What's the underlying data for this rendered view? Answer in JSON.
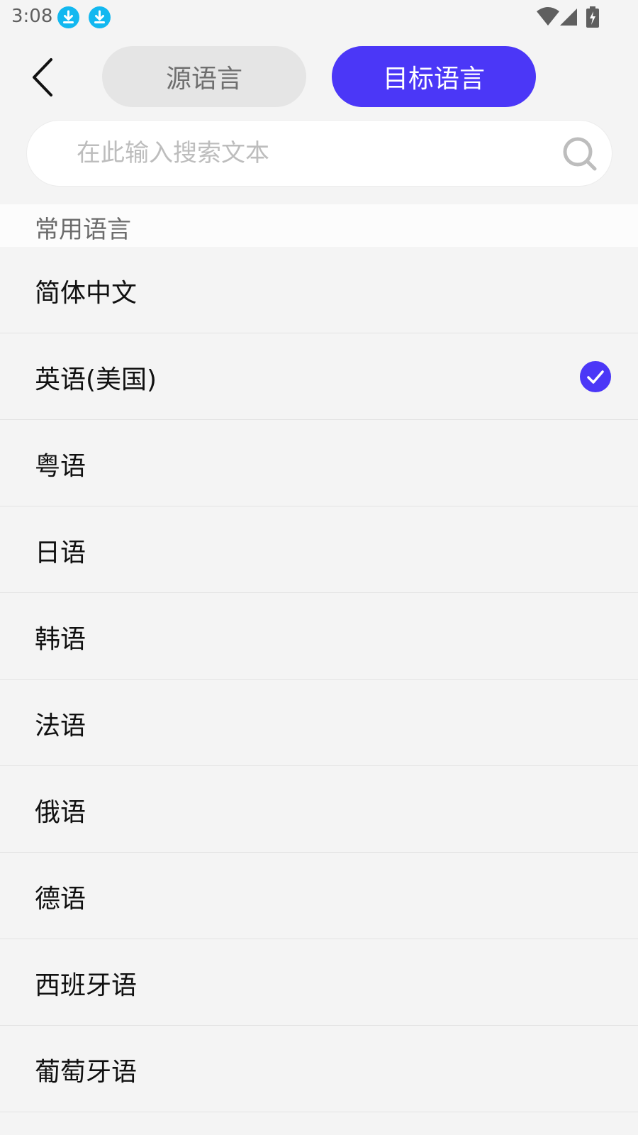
{
  "status_bar": {
    "time": "3:08",
    "left_icons": [
      "download-icon",
      "download-icon"
    ],
    "right_icons": [
      "wifi-icon",
      "cellular-signal-icon",
      "battery-charging-icon"
    ]
  },
  "header": {
    "back_icon": "chevron-left-icon",
    "tabs": [
      {
        "label": "源语言",
        "active": false
      },
      {
        "label": "目标语言",
        "active": true
      }
    ]
  },
  "search": {
    "placeholder": "在此输入搜索文本",
    "value": "",
    "icon": "search-icon"
  },
  "section": {
    "title": "常用语言"
  },
  "languages": [
    {
      "label": "简体中文",
      "selected": false
    },
    {
      "label": "英语(美国)",
      "selected": true
    },
    {
      "label": "粤语",
      "selected": false
    },
    {
      "label": "日语",
      "selected": false
    },
    {
      "label": "韩语",
      "selected": false
    },
    {
      "label": "法语",
      "selected": false
    },
    {
      "label": "俄语",
      "selected": false
    },
    {
      "label": "德语",
      "selected": false
    },
    {
      "label": "西班牙语",
      "selected": false
    },
    {
      "label": "葡萄牙语",
      "selected": false
    }
  ],
  "colors": {
    "accent": "#4b37f7",
    "status_icon_blue": "#12b8f0",
    "background": "#f4f4f4"
  }
}
